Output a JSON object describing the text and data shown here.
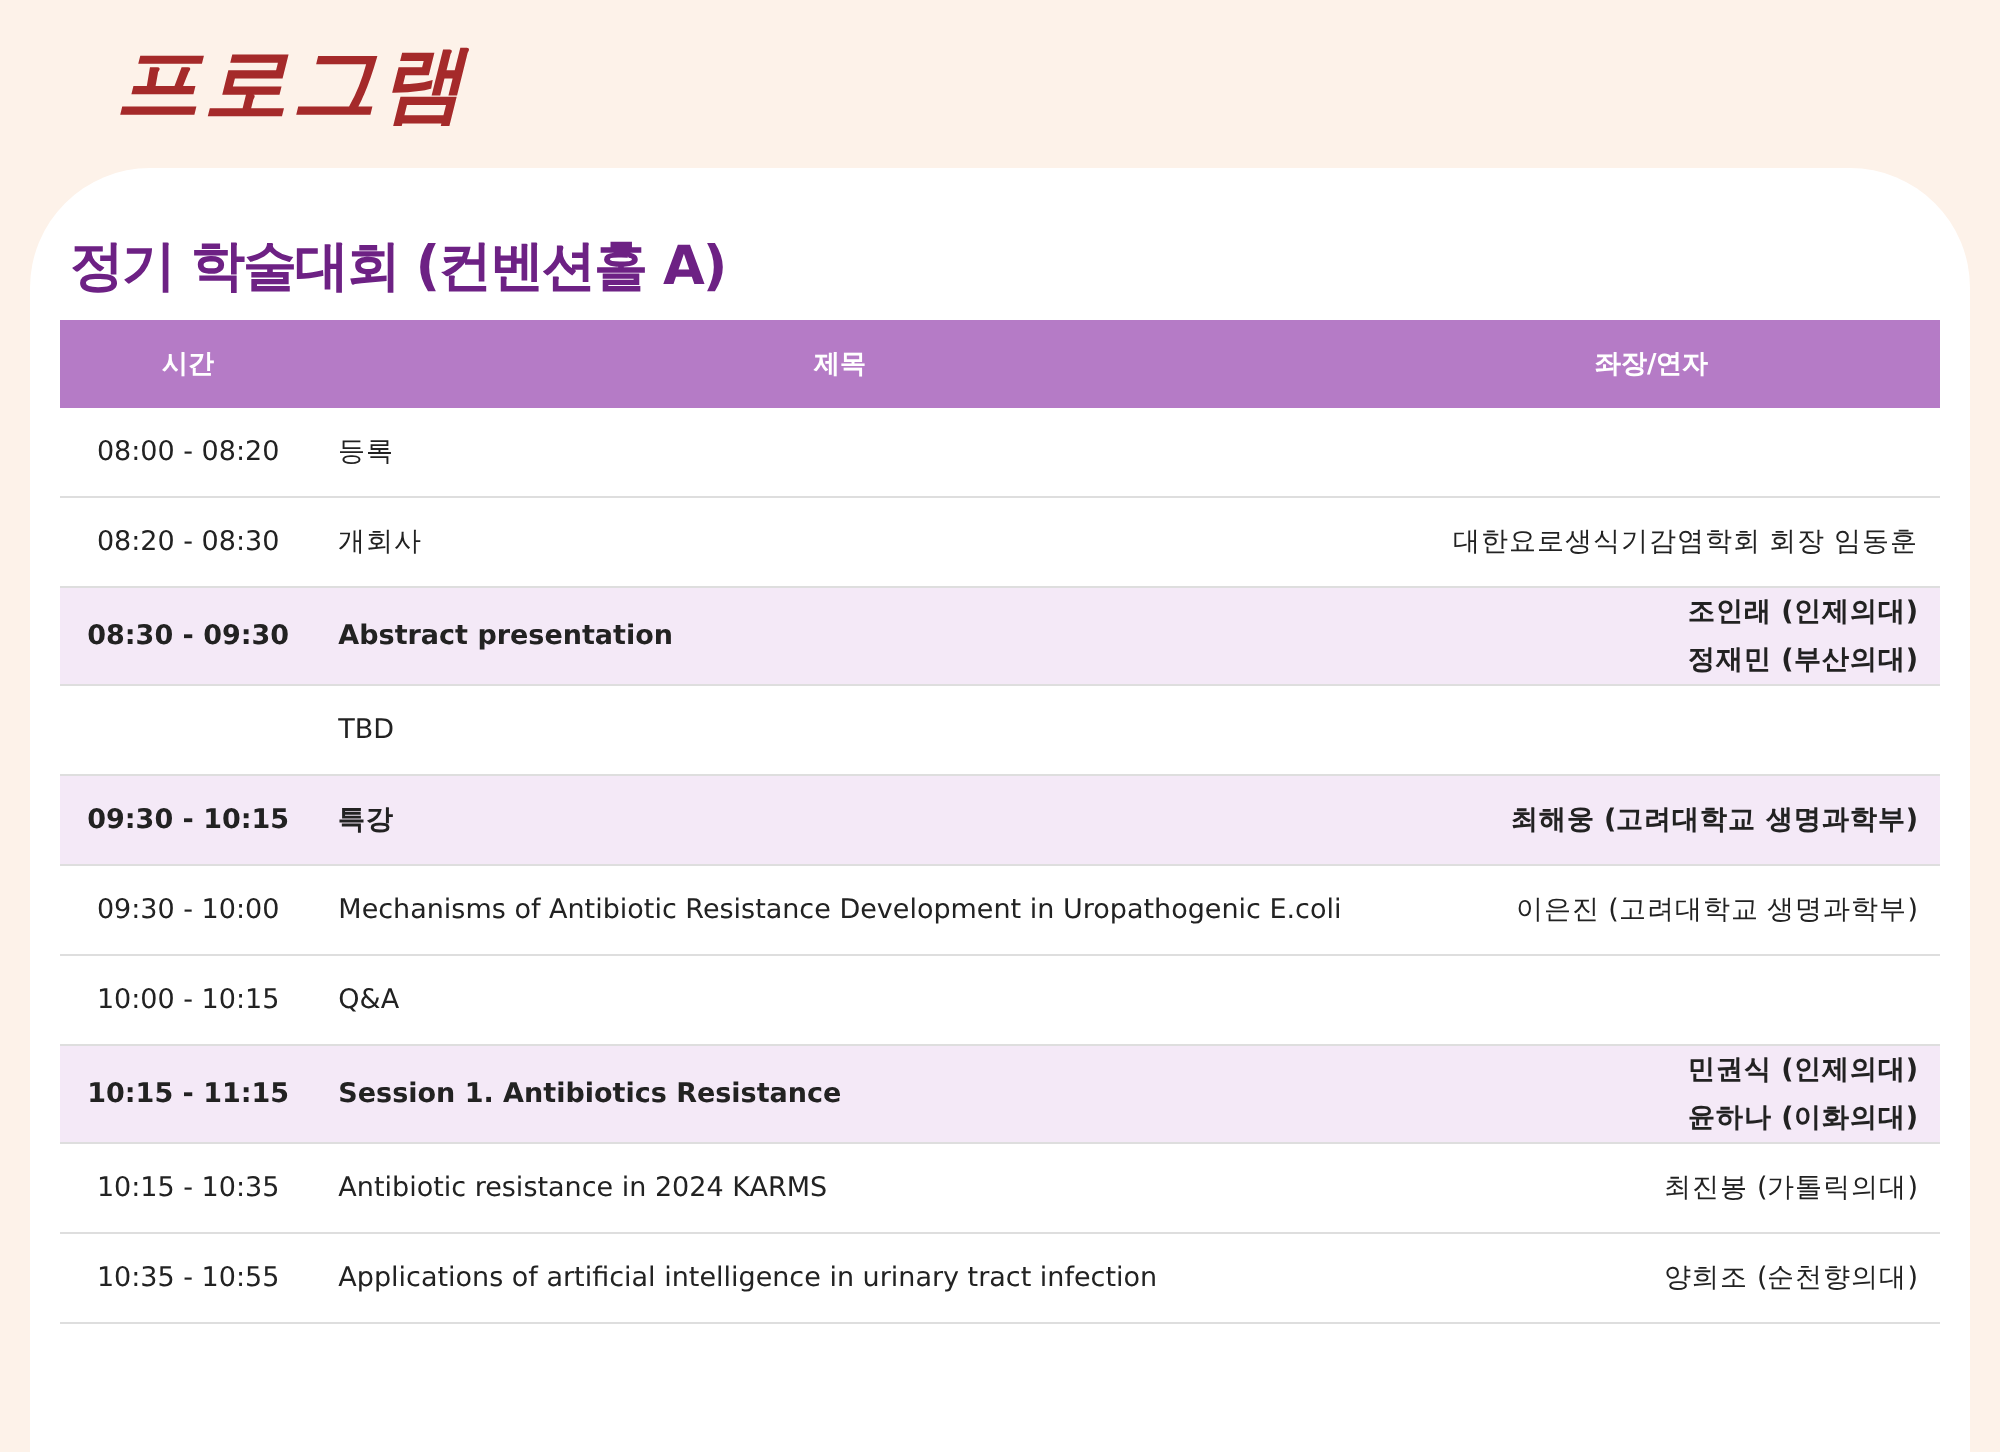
{
  "page_title": "프로그램",
  "section": {
    "title": "정기 학술대회 (컨벤션홀 A)",
    "columns": [
      "시간",
      "제목",
      "좌장/연자"
    ],
    "rows": [
      {
        "time": "08:00 - 08:20",
        "title": "등록",
        "speakers": [],
        "session": false
      },
      {
        "time": "08:20 - 08:30",
        "title": "개회사",
        "speakers": [
          "대한요로생식기감염학회 회장 임동훈"
        ],
        "session": false
      },
      {
        "time": "08:30 - 09:30",
        "title": "Abstract presentation",
        "speakers": [
          "조인래 (인제의대)",
          "정재민 (부산의대)"
        ],
        "session": true
      },
      {
        "time": "",
        "title": "TBD",
        "speakers": [],
        "session": false
      },
      {
        "time": "09:30 - 10:15",
        "title": "특강",
        "speakers": [
          "최해웅 (고려대학교 생명과학부)"
        ],
        "session": true
      },
      {
        "time": "09:30 - 10:00",
        "title": "Mechanisms of Antibiotic Resistance Development in Uropathogenic E.coli",
        "speakers": [
          "이은진 (고려대학교 생명과학부)"
        ],
        "session": false
      },
      {
        "time": "10:00 - 10:15",
        "title": "Q&A",
        "speakers": [],
        "session": false
      },
      {
        "time": "10:15 - 11:15",
        "title": "Session 1. Antibiotics Resistance",
        "speakers": [
          "민권식 (인제의대)",
          "윤하나 (이화의대)"
        ],
        "session": true
      },
      {
        "time": "10:15 - 10:35",
        "title": "Antibiotic resistance in 2024 KARMS",
        "speakers": [
          "최진봉 (가톨릭의대)"
        ],
        "session": false
      },
      {
        "time": "10:35 - 10:55",
        "title": "Applications of artificial intelligence in urinary tract infection",
        "speakers": [
          "양희조 (순천향의대)"
        ],
        "session": false
      }
    ]
  }
}
